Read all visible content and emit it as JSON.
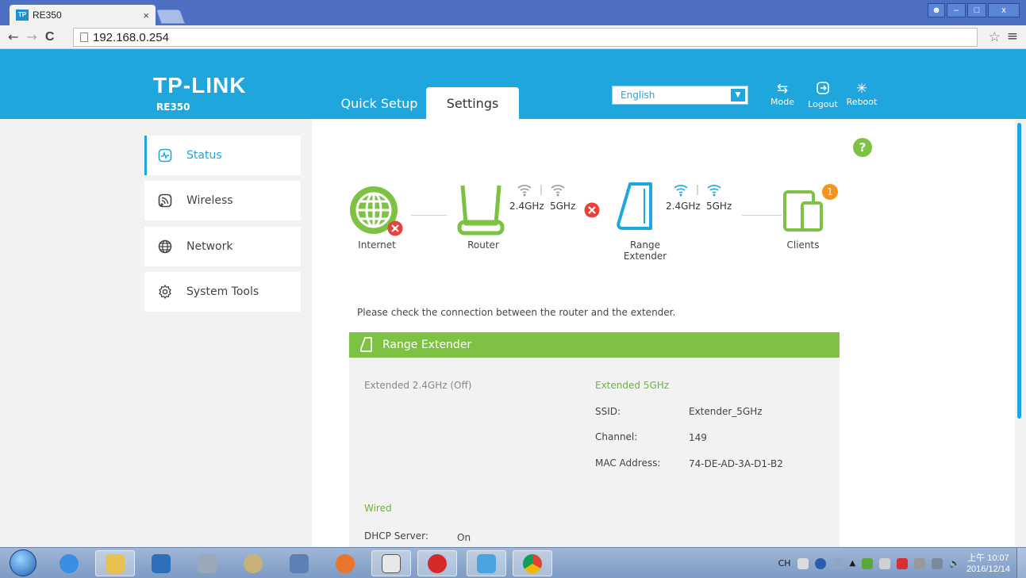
{
  "browser": {
    "tab_title": "RE350",
    "tab_close": "×",
    "favicon_text": "TP",
    "url": "192.168.0.254",
    "back": "←",
    "forward": "→",
    "reload": "C"
  },
  "header": {
    "logo": "TP-LINK",
    "model": "RE350",
    "tabs": [
      {
        "label": "Quick Setup",
        "active": false
      },
      {
        "label": "Settings",
        "active": true
      }
    ],
    "language": "English",
    "buttons": {
      "mode": "Mode",
      "logout": "Logout",
      "reboot": "Reboot"
    },
    "accent": "#1fa6dd"
  },
  "sidebar": {
    "items": [
      {
        "label": "Status",
        "icon": "status-icon",
        "active": true
      },
      {
        "label": "Wireless",
        "icon": "wireless-icon",
        "active": false
      },
      {
        "label": "Network",
        "icon": "globe-icon",
        "active": false
      },
      {
        "label": "System Tools",
        "icon": "gear-icon",
        "active": false
      }
    ]
  },
  "topology": {
    "internet_label": "Internet",
    "router_label": "Router",
    "extender_label_line1": "Range",
    "extender_label_line2": "Extender",
    "clients_label": "Clients",
    "router_freq_24": "2.4GHz",
    "router_freq_5": "5GHz",
    "extender_freq_24": "2.4GHz",
    "extender_freq_5": "5GHz",
    "clients_count": "1",
    "help": "?",
    "status_color": "#7dc242",
    "error_color": "#e8413c"
  },
  "message": "Please check the connection between the router and the extender.",
  "panel": {
    "title": "Range Extender",
    "ext24_label": "Extended 2.4GHz (Off)",
    "ext5_label": "Extended 5GHz",
    "ssid_label": "SSID:",
    "ssid_value": "Extender_5GHz",
    "channel_label": "Channel:",
    "channel_value": "149",
    "mac_label": "MAC Address:",
    "mac_value": "74-DE-AD-3A-D1-B2",
    "wired_label": "Wired",
    "dhcp_label": "DHCP Server:",
    "dhcp_value": "On"
  },
  "taskbar": {
    "lang": "CH",
    "time": "上午 10:07",
    "date": "2016/12/14"
  }
}
